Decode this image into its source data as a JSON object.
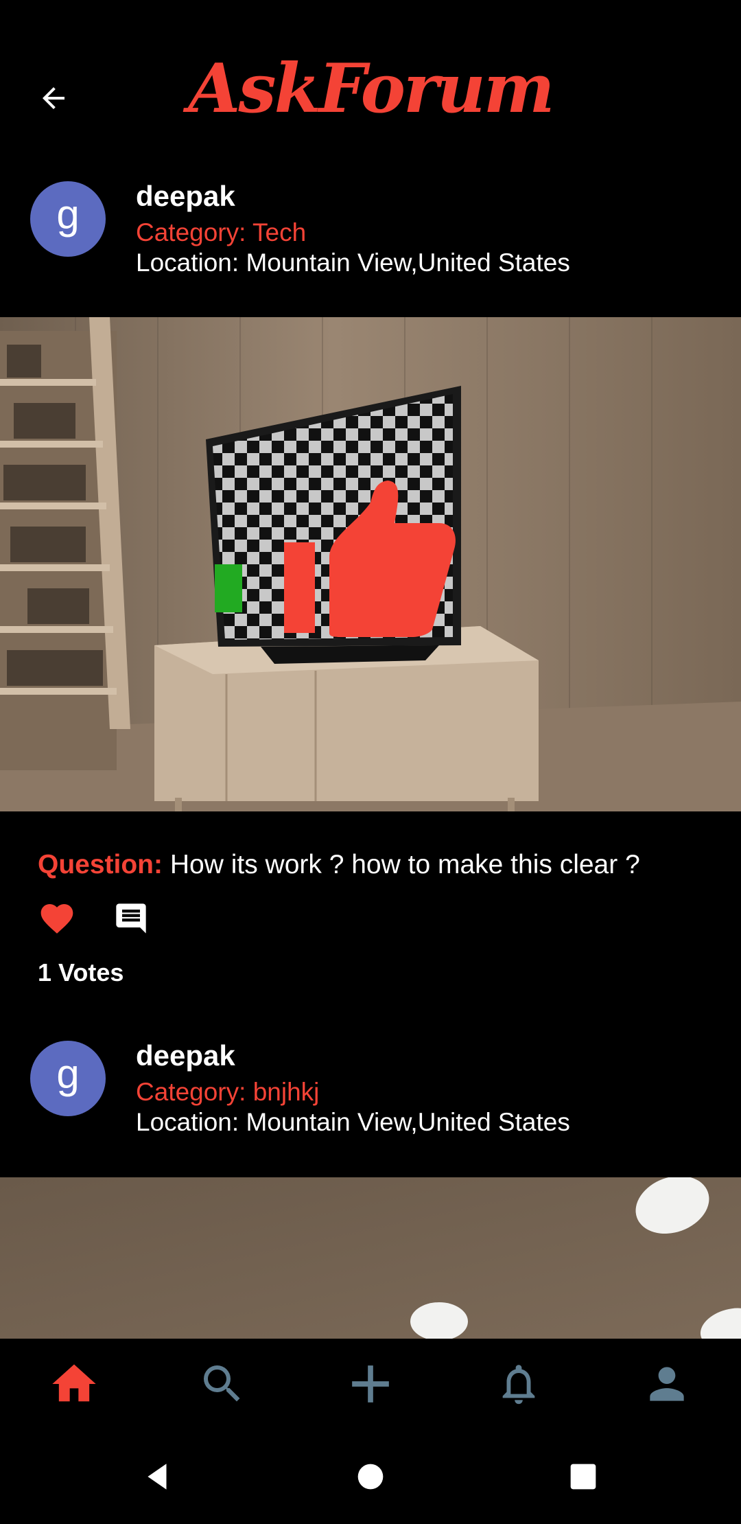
{
  "header": {
    "title": "AskForum",
    "back_icon": "arrow-back-icon"
  },
  "posts": [
    {
      "avatar_letter": "g",
      "username": "deepak",
      "category": "Category: Tech",
      "location": "Location: Mountain View,United States",
      "question_label": "Question:",
      "question_text": " How its work ? how to make this clear ?",
      "votes": "1 Votes"
    },
    {
      "avatar_letter": "g",
      "username": "deepak",
      "category": "Category: bnjhkj",
      "location": "Location: Mountain View,United States"
    }
  ],
  "bottom_nav": [
    {
      "icon": "home-icon",
      "active": true
    },
    {
      "icon": "search-icon",
      "active": false
    },
    {
      "icon": "add-icon",
      "active": false
    },
    {
      "icon": "bell-icon",
      "active": false
    },
    {
      "icon": "person-icon",
      "active": false
    }
  ],
  "colors": {
    "accent": "#f44336",
    "avatar": "#5c6bc0",
    "nav_inactive": "#5f7d90",
    "background": "#000000"
  }
}
